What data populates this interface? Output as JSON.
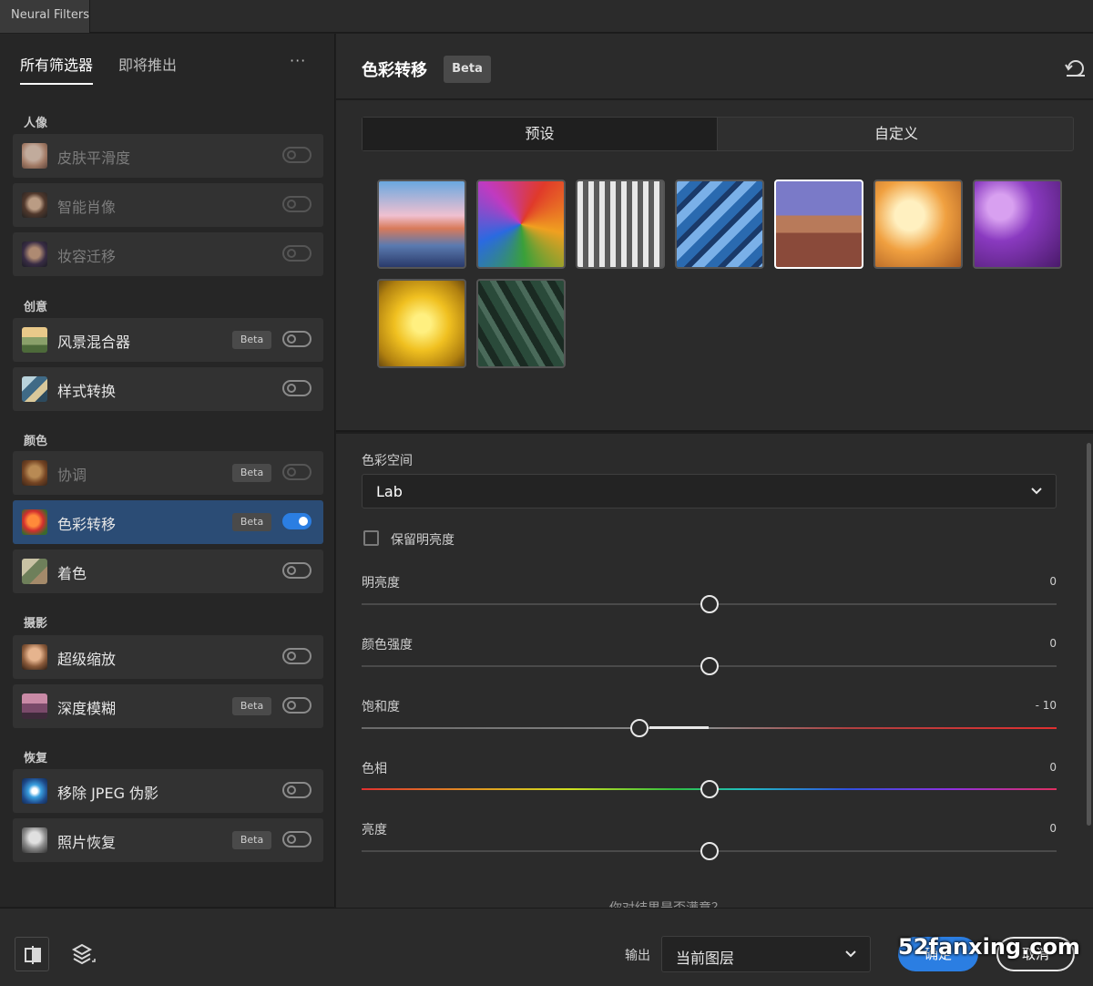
{
  "window": {
    "tab_title": "Neural Filters"
  },
  "left_panel": {
    "tabs": [
      {
        "label": "所有筛选器",
        "active": true
      },
      {
        "label": "即将推出",
        "active": false
      }
    ],
    "more_label": "···",
    "categories": [
      {
        "label": "人像"
      },
      {
        "label": "创意"
      },
      {
        "label": "颜色"
      },
      {
        "label": "摄影"
      },
      {
        "label": "恢复"
      }
    ],
    "items": [
      {
        "label": "皮肤平滑度",
        "badge": "",
        "enabled": false,
        "on": false
      },
      {
        "label": "智能肖像",
        "badge": "",
        "enabled": false,
        "on": false
      },
      {
        "label": "妆容迁移",
        "badge": "",
        "enabled": false,
        "on": false
      },
      {
        "label": "风景混合器",
        "badge": "Beta",
        "enabled": true,
        "on": false
      },
      {
        "label": "样式转换",
        "badge": "",
        "enabled": true,
        "on": false
      },
      {
        "label": "协调",
        "badge": "Beta",
        "enabled": false,
        "on": false
      },
      {
        "label": "色彩转移",
        "badge": "Beta",
        "enabled": true,
        "on": true
      },
      {
        "label": "着色",
        "badge": "",
        "enabled": true,
        "on": false
      },
      {
        "label": "超级缩放",
        "badge": "",
        "enabled": true,
        "on": false
      },
      {
        "label": "深度模糊",
        "badge": "Beta",
        "enabled": true,
        "on": false
      },
      {
        "label": "移除 JPEG 伪影",
        "badge": "",
        "enabled": true,
        "on": false
      },
      {
        "label": "照片恢复",
        "badge": "Beta",
        "enabled": true,
        "on": false
      }
    ]
  },
  "filter_header": {
    "title": "色彩转移",
    "badge": "Beta",
    "reset_icon": "reset-icon"
  },
  "presets": {
    "tabs": [
      {
        "label": "预设"
      },
      {
        "label": "自定义"
      }
    ],
    "selected_index": 4,
    "count": 9
  },
  "settings": {
    "color_space_label": "色彩空间",
    "color_space_value": "Lab",
    "preserve_luminance_label": "保留明亮度",
    "preserve_luminance_checked": false,
    "sliders": [
      {
        "label": "明亮度",
        "value": "0",
        "fraction": 0.5
      },
      {
        "label": "颜色强度",
        "value": "0",
        "fraction": 0.5
      },
      {
        "label": "饱和度",
        "value": "- 10",
        "fraction": 0.4
      },
      {
        "label": "色相",
        "value": "0",
        "fraction": 0.5
      },
      {
        "label": "亮度",
        "value": "0",
        "fraction": 0.5
      }
    ],
    "feedback_text": "你对结果是否满意？"
  },
  "footer": {
    "output_label": "输出",
    "output_value": "当前图层",
    "ok_label": "确定",
    "cancel_label": "取消",
    "watermark": "52fanxing.com"
  },
  "colors": {
    "accent": "#2b7ee2",
    "selected_item": "#2b4c75"
  }
}
